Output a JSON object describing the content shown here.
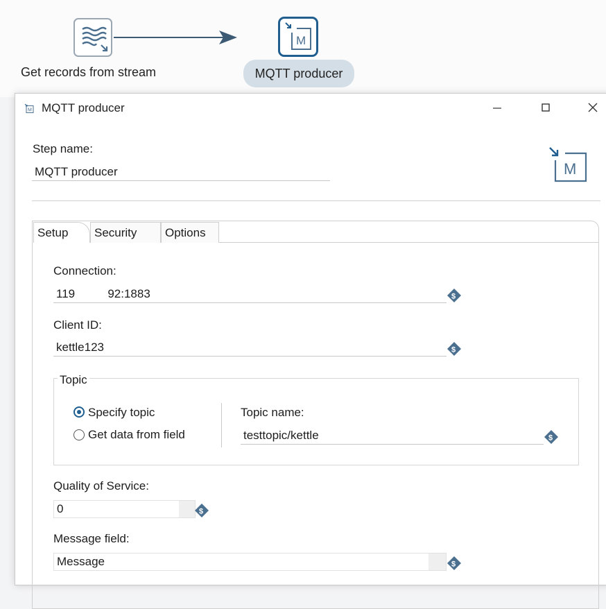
{
  "canvas": {
    "step1_label": "Get records from stream",
    "step2_label": "MQTT producer"
  },
  "dialog": {
    "title": "MQTT producer",
    "step_name_label": "Step name:",
    "step_name_value": "MQTT producer",
    "tabs": [
      "Setup",
      "Security",
      "Options"
    ],
    "active_tab": "Setup",
    "connection_label": "Connection:",
    "connection_value": "119          92:1883",
    "client_id_label": "Client ID:",
    "client_id_value": "kettle123",
    "topic_group_title": "Topic",
    "radio_specify": "Specify topic",
    "radio_field": "Get data from field",
    "selected_radio": "Specify topic",
    "topic_name_label": "Topic name:",
    "topic_name_value": "testtopic/kettle",
    "qos_label": "Quality of Service:",
    "qos_value": "0",
    "message_field_label": "Message field:",
    "message_field_value": "Message"
  },
  "colors": {
    "accent": "#1f5e8f",
    "variable_icon": "#4b6f8f"
  },
  "icons": [
    "stream-step-icon",
    "mqtt-step-icon",
    "minimize-icon",
    "maximize-icon",
    "close-icon",
    "variable-icon"
  ]
}
